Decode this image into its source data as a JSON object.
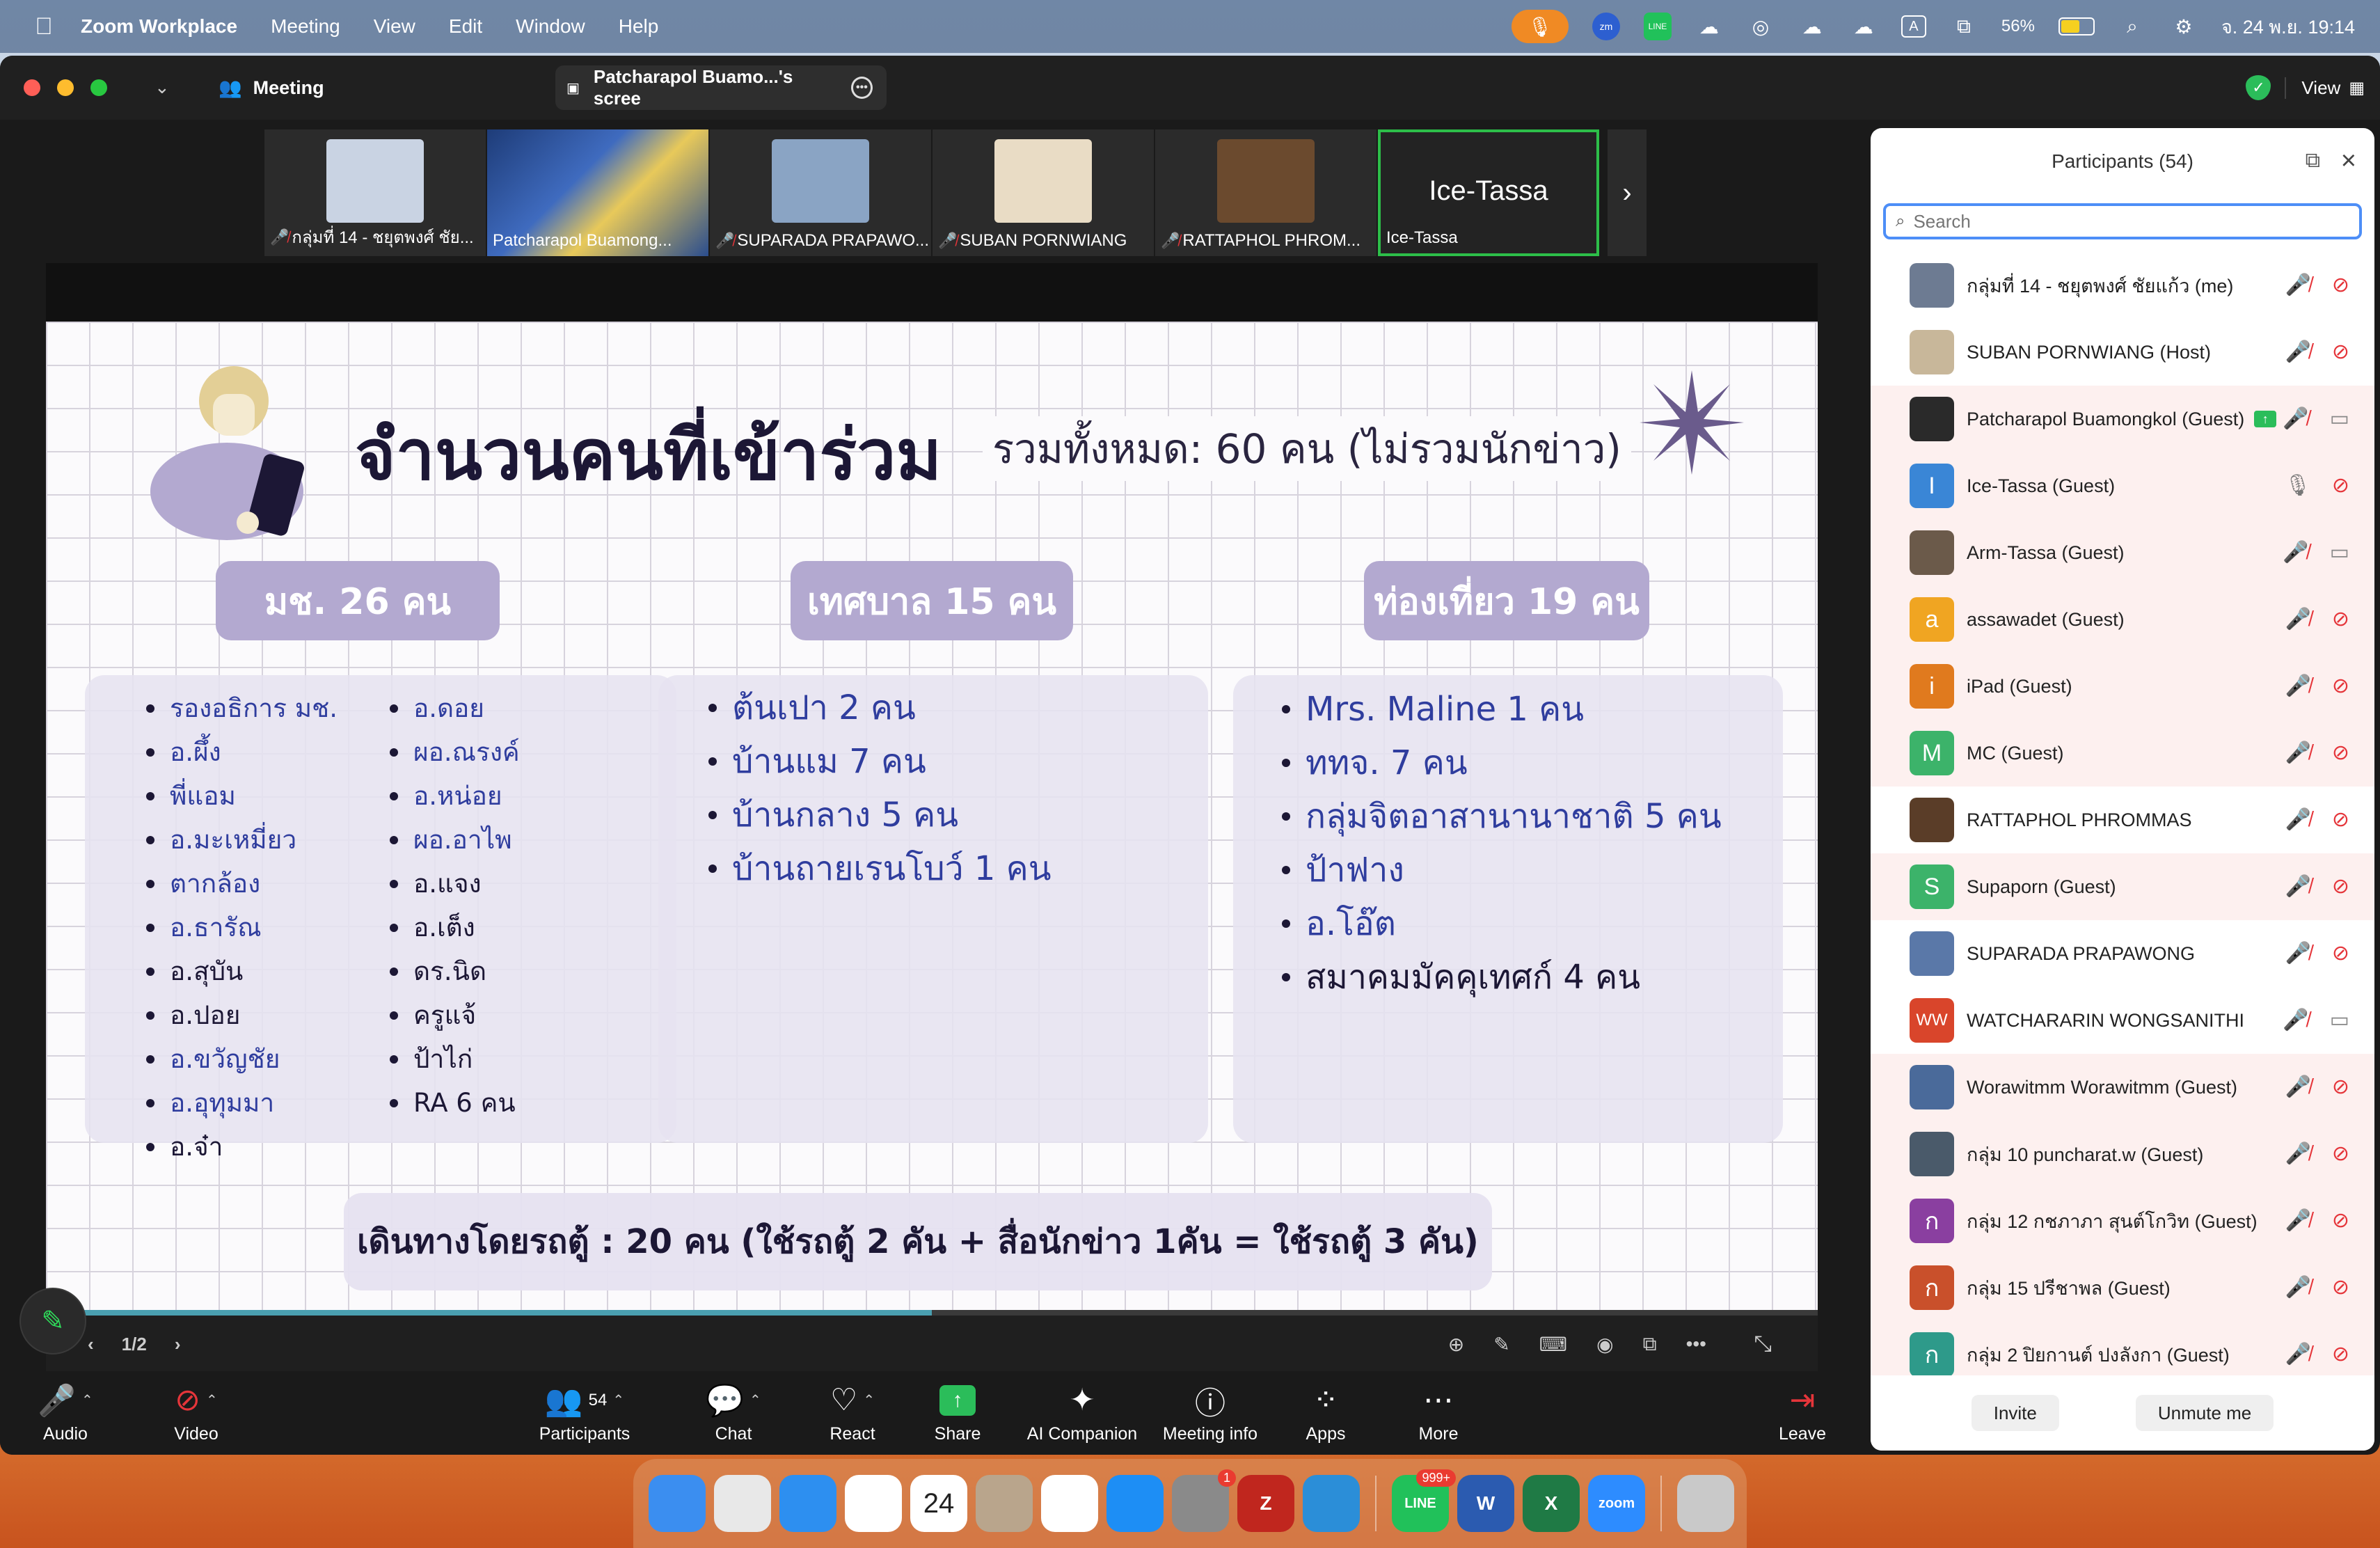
{
  "menubar": {
    "app_name": "Zoom Workplace",
    "menus": [
      "Meeting",
      "View",
      "Edit",
      "Window",
      "Help"
    ],
    "battery": "56%",
    "datetime": "จ. 24 พ.ย.  19:14"
  },
  "window": {
    "meeting_label": "Meeting",
    "share_tab_label": "Patcharapol Buamo...'s scree",
    "view_label": "View"
  },
  "thumbnails": [
    {
      "name": "กลุ่มที่ 14 - ชยุตพงศ์ ชัย...",
      "muted": true,
      "color": "#c9d3e3"
    },
    {
      "name": "Patcharapol Buamong...",
      "muted": false,
      "color": "#2d4a8a"
    },
    {
      "name": "SUPARADA PRAPAWO...",
      "muted": true,
      "color": "#8aa4c4"
    },
    {
      "name": "SUBAN PORNWIANG",
      "muted": true,
      "color": "#e9dcc5"
    },
    {
      "name": "RATTAPHOL PHROM...",
      "muted": true,
      "color": "#6b4a2e"
    }
  ],
  "active_thumb": {
    "big_name": "Ice-Tassa",
    "name": "Ice-Tassa"
  },
  "slide": {
    "title": "จำนวนคนที่เข้าร่วม",
    "subtitle": "รวมทั้งหมด: 60 คน (ไม่รวมนักข่าว)",
    "badges": [
      "มช. 26 คน",
      "เทศบาล 15 คน",
      "ท่องเที่ยว 19 คน"
    ],
    "col1a": [
      {
        "t": "รองอธิการ มช.",
        "c": "c-blue"
      },
      {
        "t": "อ.ผึ้ง",
        "c": "c-blue"
      },
      {
        "t": "พี่แอม",
        "c": "c-blue"
      },
      {
        "t": "อ.มะเหมี่ยว",
        "c": "c-blue"
      },
      {
        "t": "ตากล้อง",
        "c": "c-blue"
      },
      {
        "t": "อ.ธารัณ",
        "c": "c-blue"
      },
      {
        "t": "อ.สุบัน",
        "c": "c-dark"
      },
      {
        "t": "อ.ปอย",
        "c": "c-dark"
      },
      {
        "t": "อ.ขวัญชัย",
        "c": "c-blue"
      },
      {
        "t": "อ.อุทุมมา",
        "c": "c-blue"
      },
      {
        "t": "อ.จ๋า",
        "c": "c-dark"
      }
    ],
    "col1b": [
      {
        "t": "อ.ดอย",
        "c": "c-blue"
      },
      {
        "t": "ผอ.ณรงค์",
        "c": "c-blue"
      },
      {
        "t": "อ.หน่อย",
        "c": "c-blue"
      },
      {
        "t": "ผอ.อาไพ",
        "c": "c-blue"
      },
      {
        "t": "อ.แจง",
        "c": "c-dark"
      },
      {
        "t": "อ.เต็ง",
        "c": "c-dark"
      },
      {
        "t": "ดร.นิด",
        "c": "c-dark"
      },
      {
        "t": "ครูแจ้",
        "c": "c-dark"
      },
      {
        "t": "ป้าไก่",
        "c": "c-dark"
      },
      {
        "t": "RA 6 คน",
        "c": "c-dark"
      }
    ],
    "col2": [
      {
        "t": "ต้นเปา 2 คน",
        "c": "c-blue"
      },
      {
        "t": "บ้านแม 7 คน",
        "c": "c-blue"
      },
      {
        "t": "บ้านกลาง 5 คน",
        "c": "c-blue"
      },
      {
        "t": "บ้านถายเรนโบว์ 1 คน",
        "c": "c-blue"
      }
    ],
    "col3": [
      {
        "t": "Mrs. Maline 1 คน",
        "c": "c-blue"
      },
      {
        "t": "ททจ. 7 คน",
        "c": "c-blue"
      },
      {
        "t": "กลุ่มจิตอาสานานาชาติ 5 คน",
        "c": "c-blue"
      },
      {
        "t": "ป้าฟาง",
        "c": "c-blue"
      },
      {
        "t": "อ.โอ๊ต",
        "c": "c-blue"
      },
      {
        "t": "สมาคมมัคคุเทศก์ 4 คน",
        "c": "c-dark"
      }
    ],
    "bottom_note": "เดินทางโดยรถตู้ : 20 คน (ใช้รถตู้ 2 คัน + สื่อนักข่าว 1คัน = ใช้รถตู้ 3 คัน)",
    "progress": 0.5
  },
  "share_bar": {
    "page": "1/2"
  },
  "controls": {
    "audio": "Audio",
    "video": "Video",
    "participants": "Participants",
    "participant_count": "54",
    "chat": "Chat",
    "react": "React",
    "share": "Share",
    "ai_companion": "AI Companion",
    "meeting_info": "Meeting info",
    "apps": "Apps",
    "more": "More",
    "leave": "Leave"
  },
  "participants_panel": {
    "title": "Participants (54)",
    "search_placeholder": "Search",
    "invite": "Invite",
    "unmute_me": "Unmute me",
    "list": [
      {
        "name": "กลุ่มที่ 14 - ชยุตพงศ์ ชัยแก้ว (me)",
        "initial": "",
        "color": "#6d7b92",
        "mic": "muted",
        "cam": "off",
        "tint": false
      },
      {
        "name": "SUBAN PORNWIANG (Host)",
        "initial": "",
        "color": "#c8b79a",
        "mic": "muted",
        "cam": "off",
        "tint": false
      },
      {
        "name": "Patcharapol Buamongkol  (Guest)",
        "initial": "",
        "color": "#2a2a2a",
        "mic": "muted",
        "cam": "on",
        "tint": true,
        "sharing": true
      },
      {
        "name": "Ice-Tassa (Guest)",
        "initial": "I",
        "color": "#3a86d6",
        "mic": "on",
        "cam": "off",
        "tint": true
      },
      {
        "name": "Arm-Tassa (Guest)",
        "initial": "",
        "color": "#6b5a4a",
        "mic": "muted",
        "cam": "on",
        "tint": true
      },
      {
        "name": "assawadet (Guest)",
        "initial": "a",
        "color": "#f0a522",
        "mic": "muted",
        "cam": "off",
        "tint": true
      },
      {
        "name": "iPad (Guest)",
        "initial": "i",
        "color": "#e07a1e",
        "mic": "muted",
        "cam": "off",
        "tint": true
      },
      {
        "name": "MC (Guest)",
        "initial": "M",
        "color": "#3cb36a",
        "mic": "muted",
        "cam": "off",
        "tint": true
      },
      {
        "name": "RATTAPHOL PHROMMAS",
        "initial": "",
        "color": "#5a3d28",
        "mic": "muted",
        "cam": "off",
        "tint": false
      },
      {
        "name": "Supaporn (Guest)",
        "initial": "S",
        "color": "#3cb36a",
        "mic": "muted",
        "cam": "off",
        "tint": true
      },
      {
        "name": "SUPARADA PRAPAWONG",
        "initial": "",
        "color": "#5a78a8",
        "mic": "muted",
        "cam": "off",
        "tint": false
      },
      {
        "name": "WATCHARARIN WONGSANITHI",
        "initial": "WW",
        "color": "#d9452b",
        "mic": "muted",
        "cam": "on",
        "tint": false
      },
      {
        "name": "Worawitmm Worawitmm (Guest)",
        "initial": "",
        "color": "#4a6a9a",
        "mic": "muted",
        "cam": "off",
        "tint": true
      },
      {
        "name": "กลุ่ม 10 puncharat.w (Guest)",
        "initial": "",
        "color": "#4a5a6a",
        "mic": "muted",
        "cam": "off",
        "tint": true
      },
      {
        "name": "กลุ่ม 12 กชภาภา สุนต์โกวิท (Guest)",
        "initial": "ก",
        "color": "#8a3fa0",
        "mic": "muted",
        "cam": "off",
        "tint": true
      },
      {
        "name": "กลุ่ม 15 ปรีชาพล (Guest)",
        "initial": "ก",
        "color": "#c9502b",
        "mic": "muted",
        "cam": "off",
        "tint": true
      },
      {
        "name": "กลุ่ม 2 ปิยกานต์  ปงลังกา (Guest)",
        "initial": "ก",
        "color": "#2e9a8a",
        "mic": "muted",
        "cam": "off",
        "tint": true
      }
    ]
  },
  "dock": [
    {
      "name": "finder",
      "color": "#3b8ef0",
      "label": ""
    },
    {
      "name": "launchpad",
      "color": "#e8e8e8",
      "label": ""
    },
    {
      "name": "safari",
      "color": "#2d8ff0",
      "label": ""
    },
    {
      "name": "photos",
      "color": "#ffffff",
      "label": ""
    },
    {
      "name": "calendar",
      "color": "#ffffff",
      "label": "24"
    },
    {
      "name": "contacts",
      "color": "#b9a58c",
      "label": ""
    },
    {
      "name": "reminders",
      "color": "#ffffff",
      "label": ""
    },
    {
      "name": "app-store",
      "color": "#1d8ef5",
      "label": ""
    },
    {
      "name": "system-settings",
      "color": "#8a8a8a",
      "label": "",
      "badge": "1"
    },
    {
      "name": "filezilla",
      "color": "#c0261e",
      "label": "Z"
    },
    {
      "name": "vscode",
      "color": "#2b8ed8",
      "label": ""
    },
    {
      "name": "line",
      "color": "#21c15a",
      "label": "LINE",
      "badge": "999+"
    },
    {
      "name": "word",
      "color": "#2b5bb0",
      "label": "W"
    },
    {
      "name": "excel",
      "color": "#1f7a45",
      "label": "X"
    },
    {
      "name": "zoom",
      "color": "#2d8cff",
      "label": "zoom"
    },
    {
      "name": "trash",
      "color": "#c9c9c9",
      "label": ""
    }
  ]
}
